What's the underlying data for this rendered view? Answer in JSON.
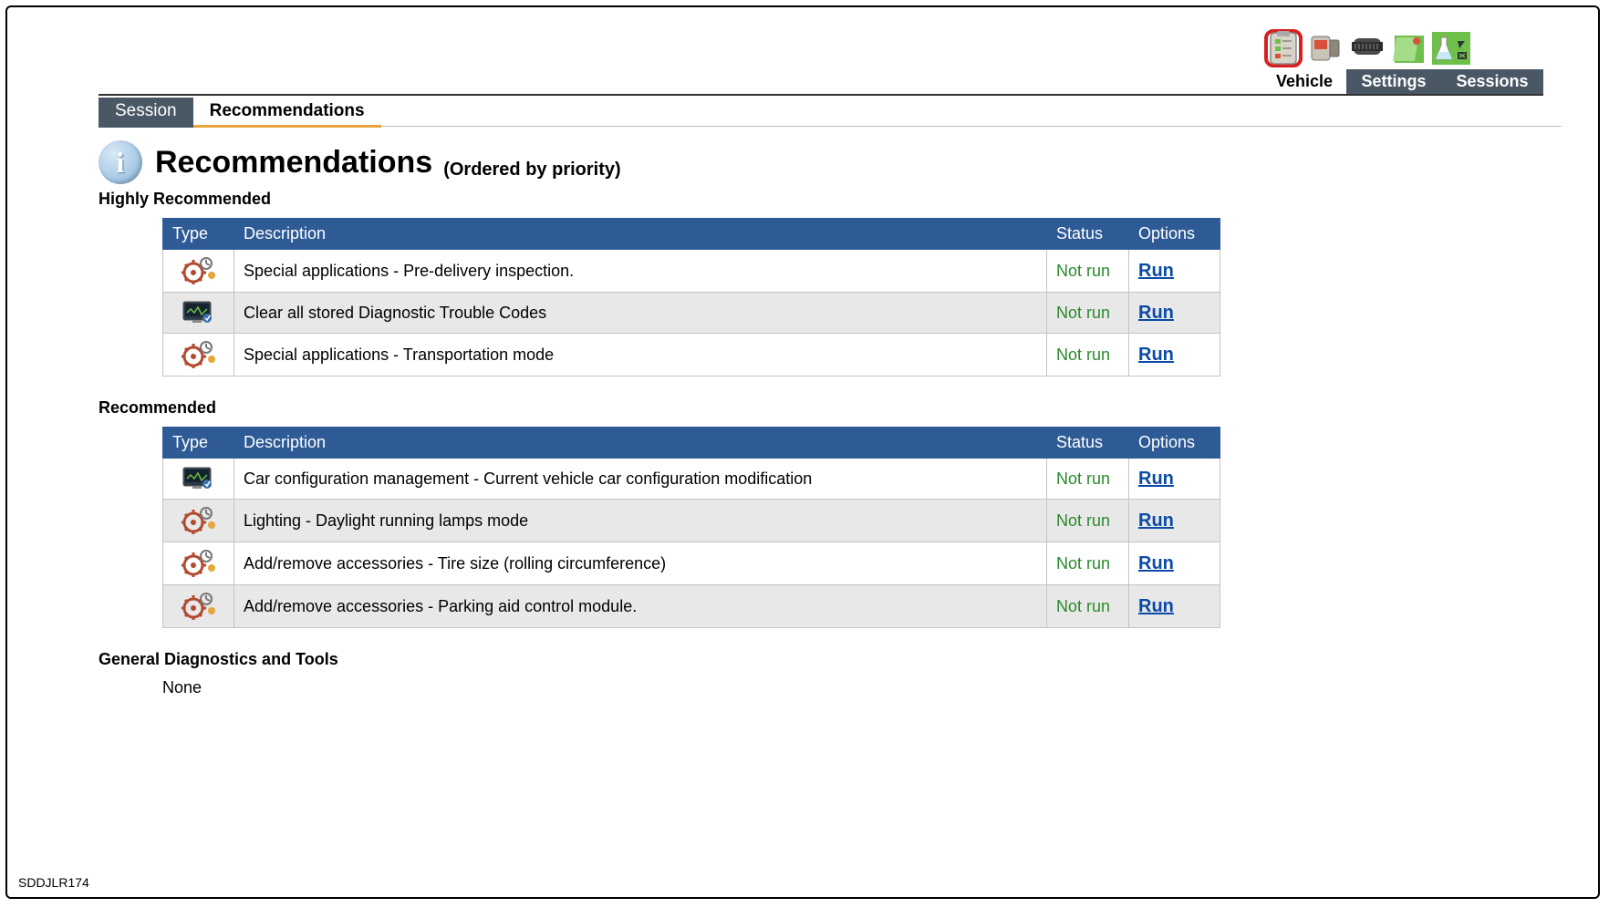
{
  "toolbar": {
    "sections": [
      {
        "label": "Vehicle",
        "active": true,
        "icon": "clipboard"
      },
      {
        "label": "Settings",
        "active": false
      },
      {
        "label": "Sessions",
        "active": false
      }
    ]
  },
  "tabs": [
    {
      "label": "Session",
      "active": false
    },
    {
      "label": "Recommendations",
      "active": true
    }
  ],
  "heading": {
    "title": "Recommendations",
    "subtitle": "(Ordered by priority)"
  },
  "table_headers": {
    "type": "Type",
    "description": "Description",
    "status": "Status",
    "options": "Options"
  },
  "run_label": "Run",
  "sections": [
    {
      "title": "Highly Recommended",
      "rows": [
        {
          "icon": "gear",
          "description": "Special applications - Pre-delivery inspection.",
          "status": "Not run"
        },
        {
          "icon": "monitor",
          "description": "Clear all stored Diagnostic Trouble Codes",
          "status": "Not run"
        },
        {
          "icon": "gear",
          "description": "Special applications - Transportation mode",
          "status": "Not run"
        }
      ]
    },
    {
      "title": "Recommended",
      "rows": [
        {
          "icon": "monitor",
          "description": "Car configuration management - Current vehicle car configuration modification",
          "status": "Not run"
        },
        {
          "icon": "gear",
          "description": "Lighting - Daylight running lamps mode",
          "status": "Not run"
        },
        {
          "icon": "gear",
          "description": "Add/remove accessories - Tire size (rolling circumference)",
          "status": "Not run"
        },
        {
          "icon": "gear",
          "description": "Add/remove accessories - Parking aid control module.",
          "status": "Not run"
        }
      ]
    },
    {
      "title": "General Diagnostics and Tools",
      "none": "None"
    }
  ],
  "footer_code": "SDDJLR174"
}
